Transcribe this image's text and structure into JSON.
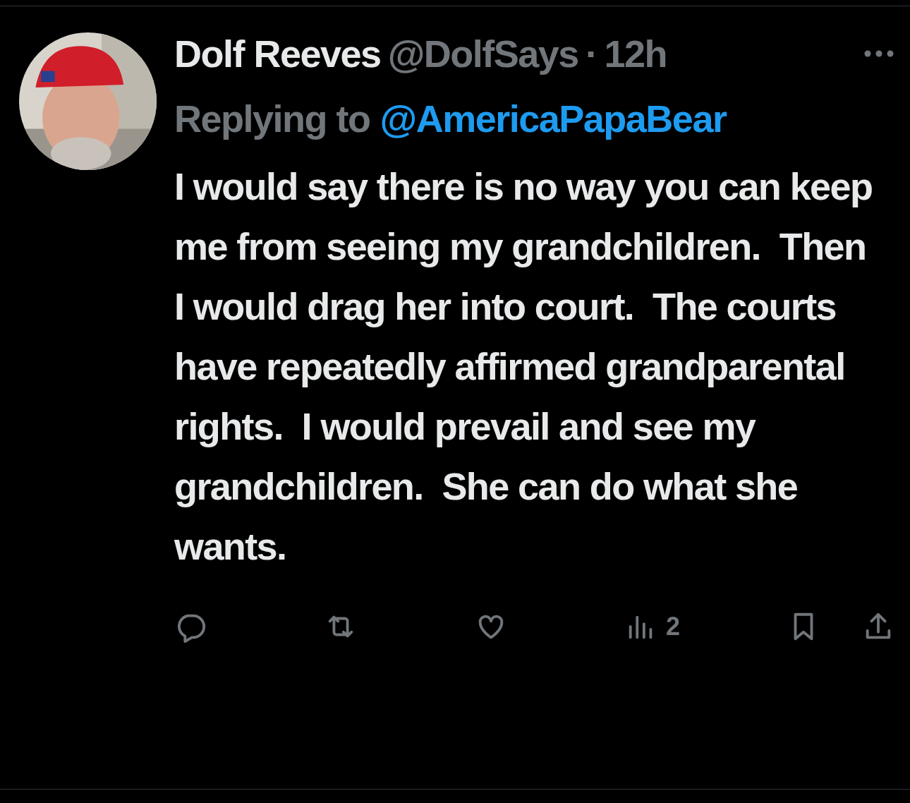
{
  "tweet": {
    "author": {
      "name": "Dolf Reeves",
      "handle": "@DolfSays",
      "separator": "·",
      "time": "12h"
    },
    "reply_to": {
      "label": "Replying to",
      "handle": "@AmericaPapaBear"
    },
    "text": "I would say there is no way you can keep me from seeing my grandchildren.  Then I would drag her into court.  The courts have repeatedly affirmed grandparental rights.  I would prevail and see my grandchildren.  She can do what she wants.",
    "actions": [
      {
        "kind": "reply"
      },
      {
        "kind": "repost"
      },
      {
        "kind": "like"
      },
      {
        "kind": "views",
        "count": "2"
      },
      {
        "kind": "bookmark"
      },
      {
        "kind": "share"
      }
    ]
  }
}
